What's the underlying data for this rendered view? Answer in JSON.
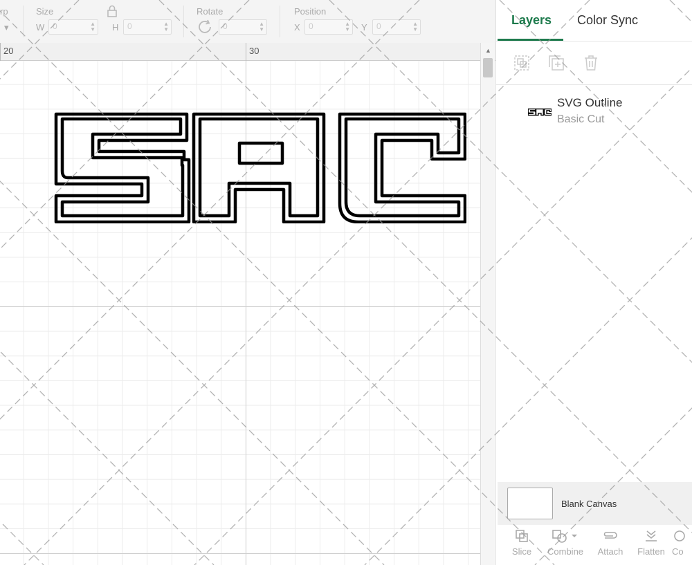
{
  "toolbar": {
    "partial_label": "rp",
    "size_label": "Size",
    "w_label": "W",
    "h_label": "H",
    "w_value": "0",
    "h_value": "0",
    "rotate_label": "Rotate",
    "rotate_value": "0",
    "position_label": "Position",
    "x_label": "X",
    "y_label": "Y",
    "x_value": "0",
    "y_value": "0",
    "icons": [
      "lock-icon",
      "rotate-icon"
    ]
  },
  "ruler": {
    "marks": [
      "20",
      "30"
    ]
  },
  "canvas": {
    "design_name": "SAC",
    "grid_color": "#cfcfcf"
  },
  "panel": {
    "tabs": [
      {
        "label": "Layers",
        "active": true
      },
      {
        "label": "Color Sync",
        "active": false
      }
    ],
    "accent": "#1d7a4c",
    "actions": [
      "group-icon",
      "duplicate-icon",
      "delete-icon"
    ],
    "layers": [
      {
        "title": "SVG Outline",
        "subtitle": "Basic Cut"
      }
    ],
    "canvas_swatch_label": "Blank Canvas",
    "tools": [
      "Slice",
      "Combine",
      "Attach",
      "Flatten",
      "Co"
    ]
  }
}
